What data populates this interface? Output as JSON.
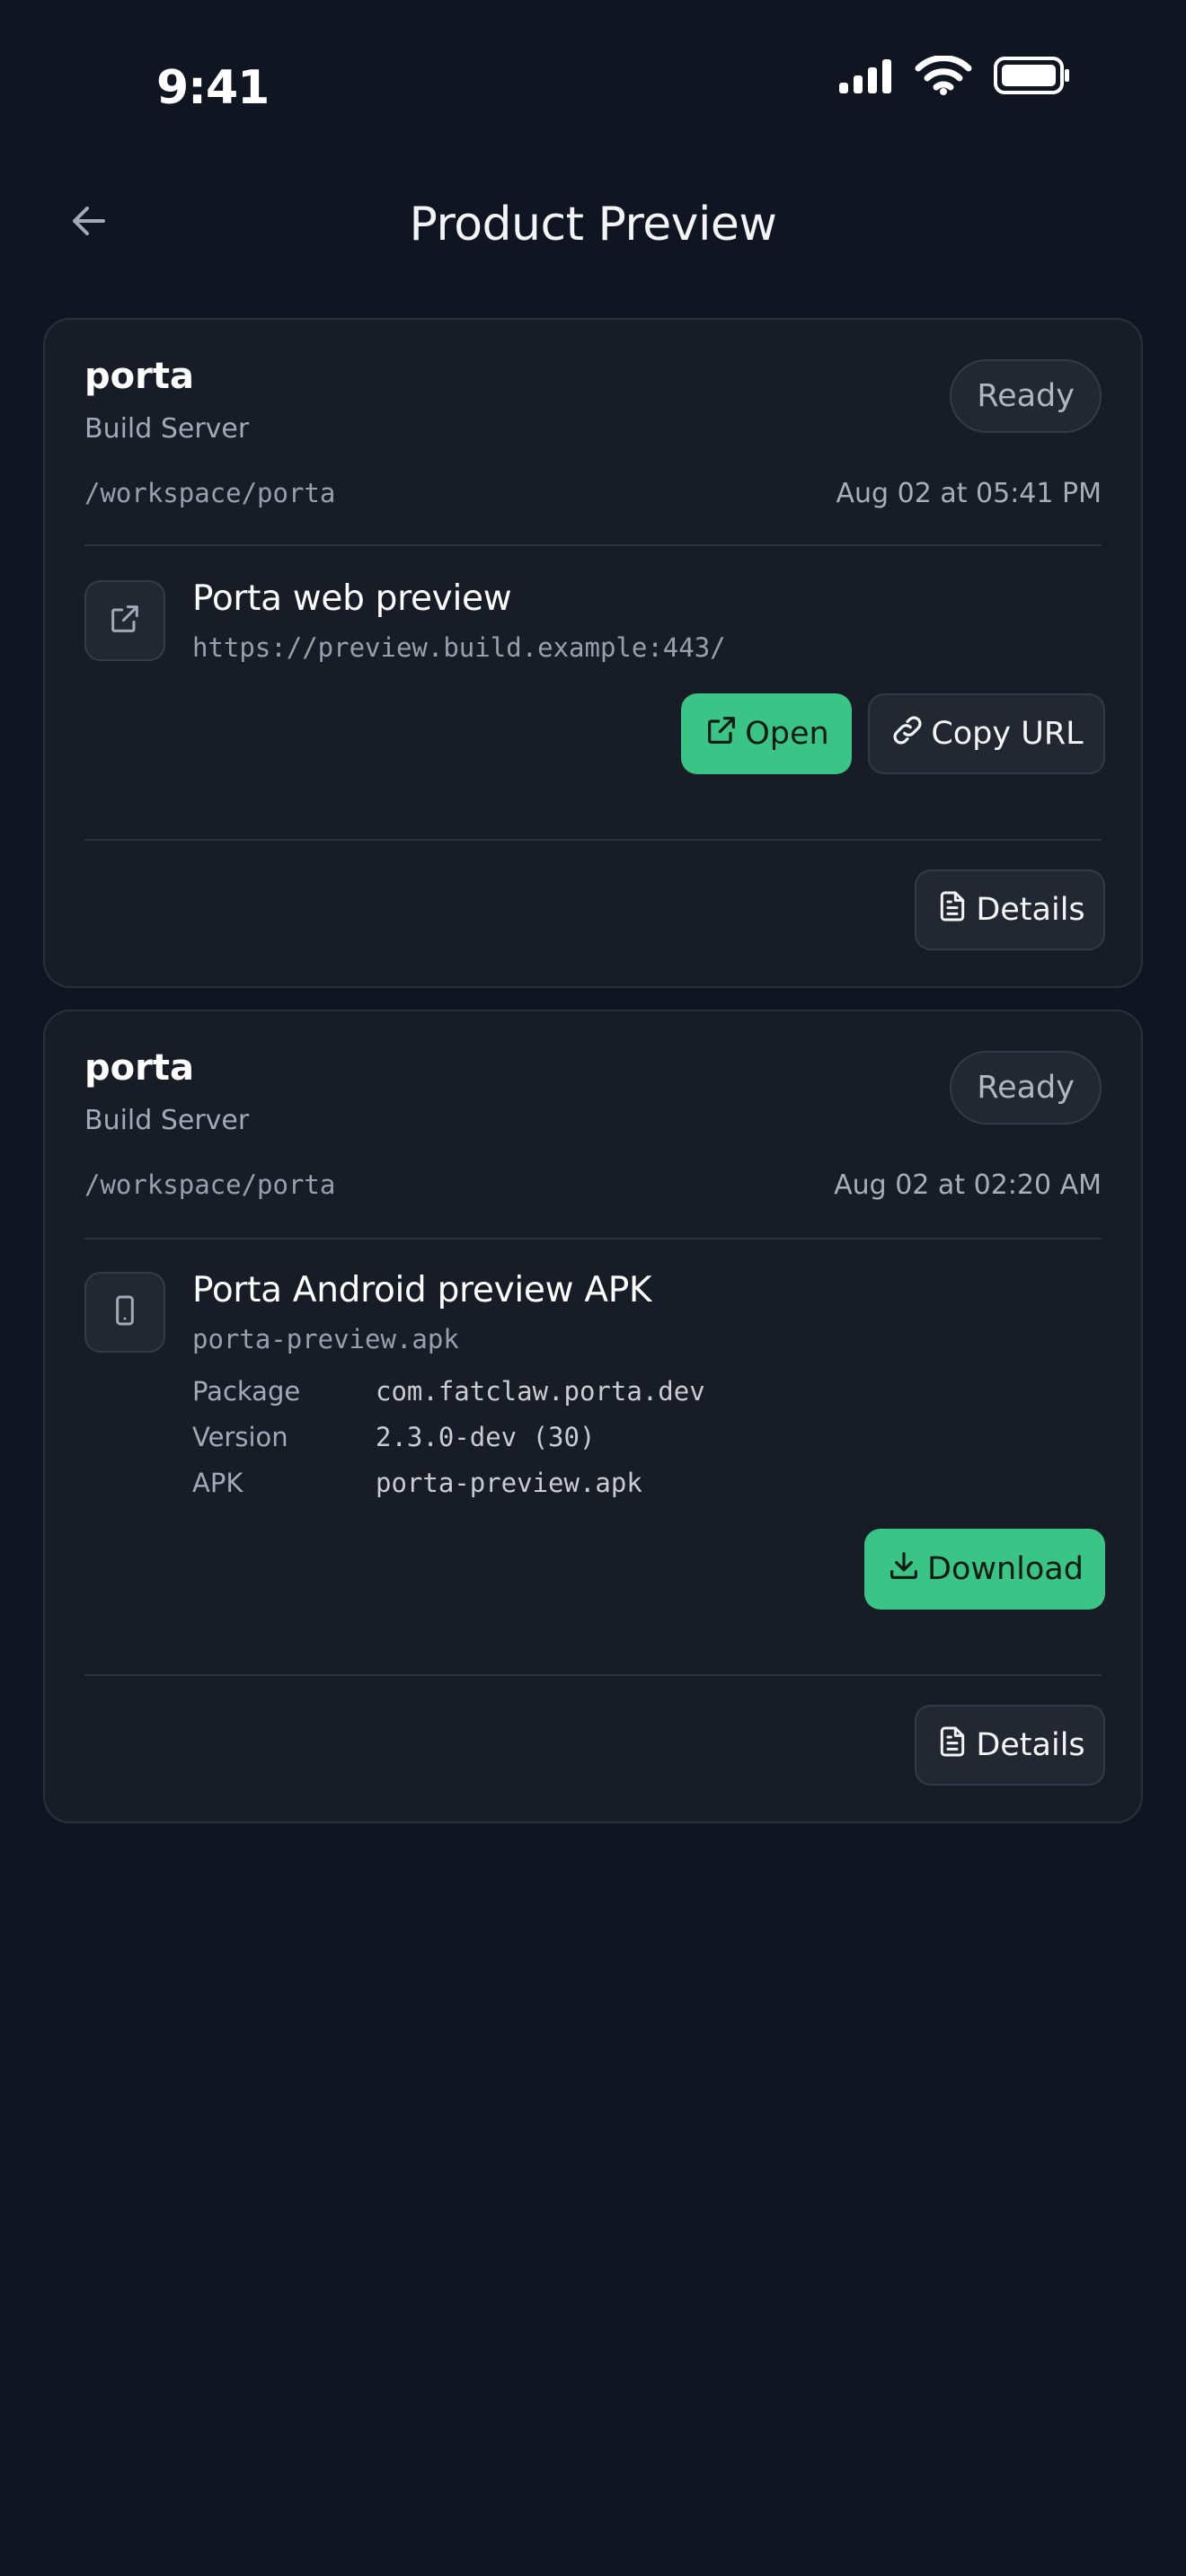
{
  "status_bar": {
    "time": "9:41"
  },
  "header": {
    "title": "Product Preview"
  },
  "cards": [
    {
      "title": "porta",
      "subtitle": "Build Server",
      "status": "Ready",
      "path": "/workspace/porta",
      "date": "Aug 02 at 05:41 PM",
      "item": {
        "title": "Porta web preview",
        "url": "https://preview.build.example:443/"
      },
      "open_label": "Open",
      "copy_label": "Copy URL",
      "details_label": "Details"
    },
    {
      "title": "porta",
      "subtitle": "Build Server",
      "status": "Ready",
      "path": "/workspace/porta",
      "date": "Aug 02 at 02:20 AM",
      "item": {
        "title": "Porta Android preview APK",
        "file": "porta-preview.apk",
        "fields": [
          {
            "label": "Package",
            "value": "com.fatclaw.porta.dev"
          },
          {
            "label": "Version",
            "value": "2.3.0-dev (30)"
          },
          {
            "label": "APK",
            "value": "porta-preview.apk"
          }
        ]
      },
      "download_label": "Download",
      "details_label": "Details"
    }
  ],
  "colors": {
    "background": "#111522",
    "card": "#181c26",
    "accent": "#3ac486",
    "border": "#2b303b"
  }
}
